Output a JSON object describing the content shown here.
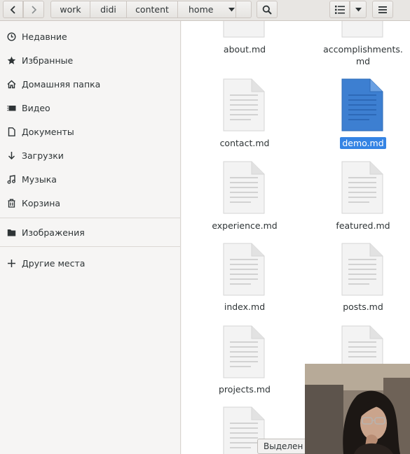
{
  "header": {
    "back_icon": "chevron-left-icon",
    "forward_icon": "chevron-right-icon",
    "breadcrumbs": [
      "work",
      "didi",
      "content",
      "home"
    ],
    "dropdown_icon": "triangle-down-icon",
    "search_icon": "search-icon",
    "view_icon": "list-view-icon",
    "view_dropdown_icon": "triangle-down-icon",
    "menu_icon": "hamburger-menu-icon"
  },
  "sidebar": {
    "items": [
      {
        "label": "Недавние",
        "icon": "clock-icon"
      },
      {
        "label": "Избранные",
        "icon": "star-icon"
      },
      {
        "label": "Домашняя папка",
        "icon": "home-icon"
      },
      {
        "label": "Видео",
        "icon": "video-icon"
      },
      {
        "label": "Документы",
        "icon": "document-icon"
      },
      {
        "label": "Загрузки",
        "icon": "download-icon"
      },
      {
        "label": "Музыка",
        "icon": "music-icon"
      },
      {
        "label": "Корзина",
        "icon": "trash-icon"
      },
      {
        "label": "Изображения",
        "icon": "folder-icon"
      },
      {
        "label": "Другие места",
        "icon": "plus-icon"
      }
    ]
  },
  "files": [
    {
      "name": "about.md"
    },
    {
      "name": "accomplishments.",
      "name2": "md"
    },
    {
      "name": "contact.md"
    },
    {
      "name": "demo.md",
      "selected": true
    },
    {
      "name": "experience.md"
    },
    {
      "name": "featured.md"
    },
    {
      "name": "index.md"
    },
    {
      "name": "posts.md"
    },
    {
      "name": "projects.md"
    },
    {
      "name": ""
    },
    {
      "name": ""
    }
  ],
  "tooltip": "Выделен «",
  "colors": {
    "accent": "#3584e4",
    "doc_selected": "#3d7fd1",
    "doc_plain": "#f1f1f1"
  }
}
